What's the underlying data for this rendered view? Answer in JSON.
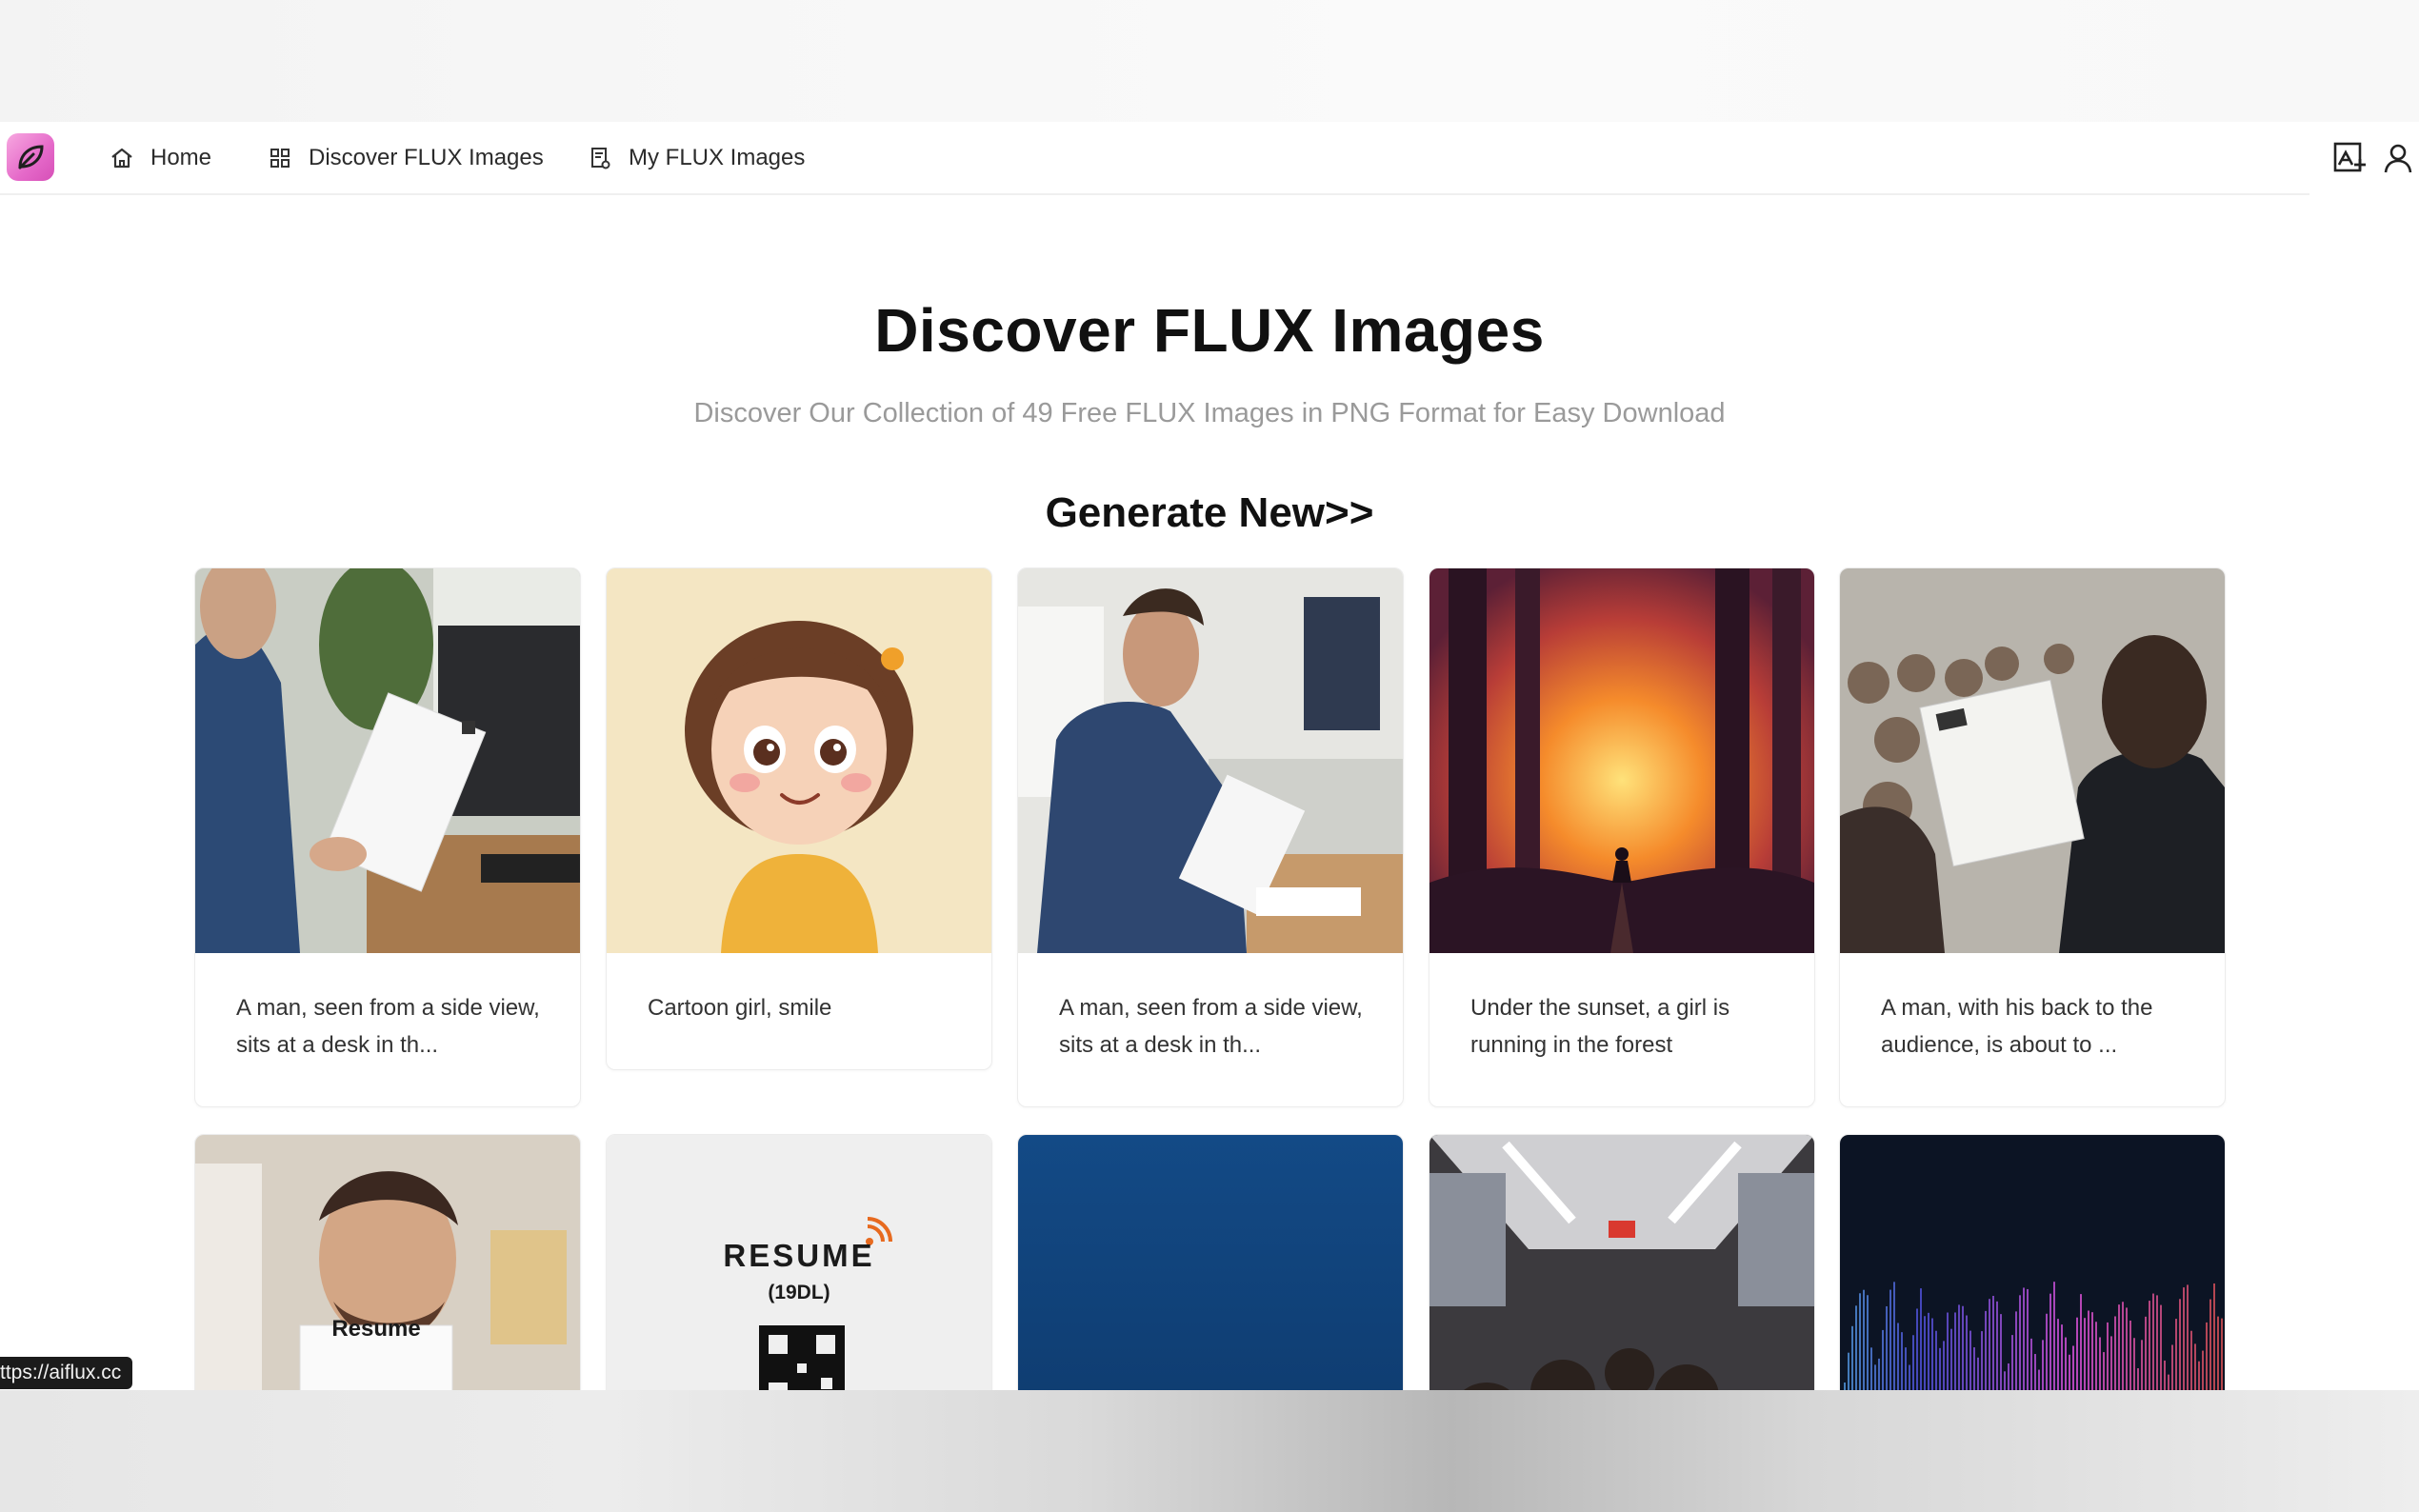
{
  "nav": {
    "home": "Home",
    "discover": "Discover FLUX Images",
    "my_images": "My FLUX Images"
  },
  "hero": {
    "title": "Discover FLUX Images",
    "subtitle": "Discover Our Collection of 49 Free FLUX Images in PNG Format for Easy Download",
    "generate_link": "Generate New>>"
  },
  "cards_row1": [
    {
      "caption": "A man, seen from a side view, sits at a desk in th...",
      "image": "man-reading-resume-side"
    },
    {
      "caption": "Cartoon girl, smile",
      "image": "cartoon-girl"
    },
    {
      "caption": "A man, seen from a side view, sits at a desk in th...",
      "image": "man-at-desk-office"
    },
    {
      "caption": "Under the sunset, a girl is running in the forest",
      "image": "sunset-forest-girl"
    },
    {
      "caption": "A man, with his back to the audience, is about to ...",
      "image": "man-back-audience"
    }
  ],
  "cards_row2": [
    {
      "image": "man-holding-resume",
      "sign_text": "Resume"
    },
    {
      "image": "resume-qr-poster",
      "title_text": "RESUME",
      "code_text": "(19DL)"
    },
    {
      "image": "blue-water"
    },
    {
      "image": "crowded-subway"
    },
    {
      "image": "sound-wave"
    }
  ],
  "status_url": "ttps://aiflux.cc",
  "colors": {
    "logo_gradient_start": "#f7a8e0",
    "logo_gradient_end": "#d64fb7",
    "title": "#111111",
    "subtitle": "#9a9a9a"
  },
  "icons": {
    "logo": "leaf-icon",
    "home": "home-icon",
    "discover": "grid-icon",
    "my_images": "document-icon",
    "generate": "image-add-icon",
    "user": "user-icon"
  }
}
